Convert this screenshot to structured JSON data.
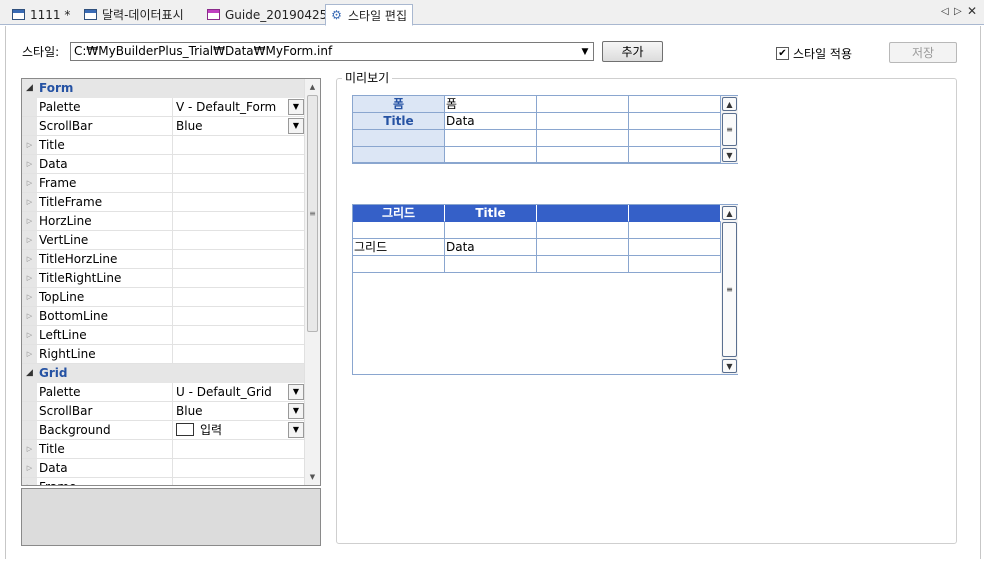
{
  "tabs": [
    {
      "label": "1111 *",
      "icon": "window-icon"
    },
    {
      "label": "달력-데이터표시",
      "icon": "window-icon"
    },
    {
      "label": "Guide_20190425",
      "icon": "window-pink-icon"
    },
    {
      "label": "스타일 편집",
      "icon": "gear-icon",
      "active": true
    }
  ],
  "tab_controls": {
    "prev": "◁",
    "next": "▷",
    "close": "✕"
  },
  "toolbar": {
    "style_label": "스타일:",
    "style_path": "C:₩MyBuilderPlus_Trial₩Data₩MyForm.inf",
    "add_label": "추가",
    "apply_style_label": "스타일 적용",
    "apply_style_checked": true,
    "save_label": "저장"
  },
  "property_grid": {
    "form_category": "Form",
    "grid_category": "Grid",
    "form_palette": {
      "name": "Palette",
      "value": "V - Default_Form"
    },
    "form_scrollbar": {
      "name": "ScrollBar",
      "value": "Blue"
    },
    "form_rows": [
      "Title",
      "Data",
      "Frame",
      "TitleFrame",
      "HorzLine",
      "VertLine",
      "TitleHorzLine",
      "TitleRightLine",
      "TopLine",
      "BottomLine",
      "LeftLine",
      "RightLine"
    ],
    "grid_palette": {
      "name": "Palette",
      "value": "U - Default_Grid"
    },
    "grid_scrollbar": {
      "name": "ScrollBar",
      "value": "Blue"
    },
    "grid_background": {
      "name": "Background",
      "value": "입력"
    },
    "grid_rows": [
      "Title",
      "Data",
      "Frame"
    ]
  },
  "preview": {
    "group_title": "미리보기",
    "form_preview": {
      "rows": [
        [
          "폼",
          "폼",
          "",
          ""
        ],
        [
          "Title",
          "Data",
          "",
          ""
        ],
        [
          "",
          "",
          "",
          ""
        ],
        [
          "",
          "",
          "",
          ""
        ]
      ]
    },
    "grid_preview": {
      "header": [
        "그리드",
        "Title",
        "",
        ""
      ],
      "rows": [
        [
          "",
          "",
          "",
          ""
        ],
        [
          "그리드",
          "Data",
          "",
          ""
        ],
        [
          "",
          "",
          "",
          ""
        ]
      ]
    }
  },
  "colors": {
    "accent": "#3560c8",
    "header_fill": "#dce6f5",
    "category_text": "#2552a3",
    "grid_line": "#8aa6cf"
  }
}
